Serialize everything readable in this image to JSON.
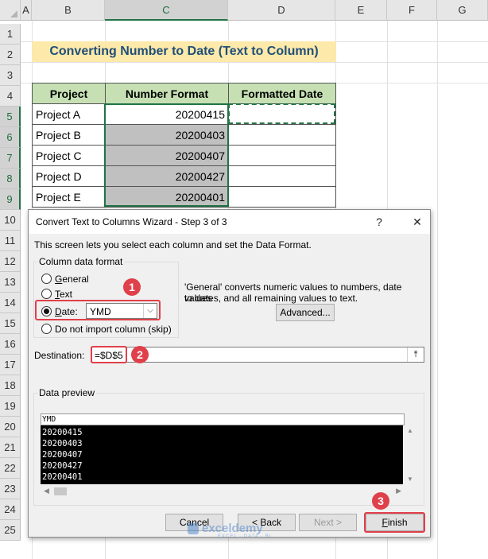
{
  "sheet": {
    "columns": [
      "A",
      "B",
      "C",
      "D",
      "E",
      "F",
      "G"
    ],
    "rows": [
      "1",
      "2",
      "3",
      "4",
      "5",
      "6",
      "7",
      "8",
      "9",
      "10",
      "11",
      "12",
      "13",
      "14",
      "15",
      "16",
      "17",
      "18",
      "19",
      "20",
      "21",
      "22",
      "23",
      "24",
      "25"
    ],
    "title": "Converting Number to Date (Text to Column)",
    "headers": [
      "Project",
      "Number Format",
      "Formatted Date"
    ],
    "data": [
      {
        "project": "Project A",
        "number": "20200415",
        "date": ""
      },
      {
        "project": "Project B",
        "number": "20200403",
        "date": ""
      },
      {
        "project": "Project C",
        "number": "20200407",
        "date": ""
      },
      {
        "project": "Project D",
        "number": "20200427",
        "date": ""
      },
      {
        "project": "Project E",
        "number": "20200401",
        "date": ""
      }
    ]
  },
  "dialog": {
    "title": "Convert Text to Columns Wizard - Step 3 of 3",
    "help_icon": "?",
    "close_icon": "✕",
    "description": "This screen lets you select each column and set the Data Format.",
    "format_group_label": "Column data format",
    "radio_general": "General",
    "radio_text": "Text",
    "radio_date": "Date:",
    "date_format_value": "YMD",
    "radio_skip": "Do not import column (skip)",
    "selected_format": "Date",
    "info_text_line1": "'General' converts numeric values to numbers, date values",
    "info_text_line2": "to dates, and all remaining values to text.",
    "advanced_button": "Advanced...",
    "destination_label": "Destination:",
    "destination_value": "=$D$5",
    "preview_label": "Data preview",
    "preview_header": "YMD",
    "preview_rows": [
      "20200415",
      "20200403",
      "20200407",
      "20200427",
      "20200401"
    ],
    "cancel_button": "Cancel",
    "back_button": "< Back",
    "next_button": "Next >",
    "finish_button": "Finish"
  },
  "annotations": {
    "step1": "1",
    "step2": "2",
    "step3": "3"
  },
  "watermark": {
    "brand": "exceldemy",
    "tagline": "EXCEL · DATA · BI"
  },
  "colors": {
    "title_bg": "#fde9a9",
    "title_text": "#1f4e79",
    "header_bg": "#c6e0b4",
    "highlight_red": "#e0404a",
    "excel_green": "#217346"
  }
}
